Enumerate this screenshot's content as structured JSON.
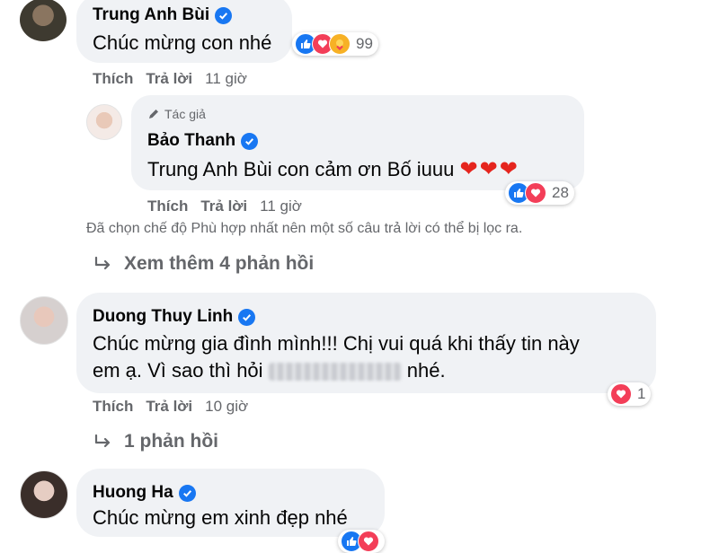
{
  "comments": [
    {
      "name": "Trung Anh Bùi",
      "text": "Chúc mừng con nhé",
      "like_label": "Thích",
      "reply_label": "Trả lời",
      "time": "11 giờ",
      "reaction_icons": [
        "like-icon",
        "love-icon",
        "care-icon"
      ],
      "reaction_count": "99"
    },
    {
      "author_badge": "Tác giả",
      "name": "Bảo Thanh",
      "tag": "Trung Anh Bùi",
      "text": "con cảm ơn Bố iuuu",
      "hearts": "❤❤❤",
      "like_label": "Thích",
      "reply_label": "Trả lời",
      "time": "11 giờ",
      "reaction_icons": [
        "like-icon",
        "love-icon"
      ],
      "reaction_count": "28"
    },
    {
      "name": "Duong Thuy Linh",
      "text_line1": "Chúc mừng gia đình mình!!! Chị vui quá khi thấy tin này",
      "text_line2_a": "em ạ. Vì sao thì hỏi",
      "text_line2_b": "nhé.",
      "like_label": "Thích",
      "reply_label": "Trả lời",
      "time": "10 giờ",
      "reaction_icons": [
        "love-icon"
      ],
      "reaction_count": "1"
    },
    {
      "name": "Huong Ha",
      "text": "Chúc mừng em xinh đẹp nhé",
      "reaction_icons": [
        "like-icon",
        "love-icon"
      ]
    }
  ],
  "filter_notice": "Đã chọn chế độ Phù hợp nhất nên một số câu trả lời có thể bị lọc ra.",
  "view_more_replies": "Xem thêm 4 phản hồi",
  "replies_link": "1 phản hồi",
  "colors": {
    "bubble": "#f0f2f5",
    "secondary_text": "#65676b",
    "verified": "#1877f2",
    "like": "#1877f2",
    "love": "#f33e58",
    "care": "#f7b125"
  }
}
